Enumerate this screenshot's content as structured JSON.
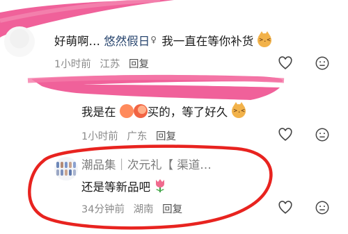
{
  "comments": [
    {
      "text_prefix": "好萌啊… ",
      "nickname": "悠然假日",
      "nickname_icon": "♀",
      "text_suffix": "我一直在等你补货",
      "emoji": "cat-emoji",
      "time": "1小时前",
      "location": "江苏",
      "reply": "回复"
    },
    {
      "text": "我是在",
      "emoji_1": "shrimp-emoji",
      "emoji_2": "peach-emoji",
      "text_suffix": "买的，等了好久",
      "emoji_3": "cat-emoji",
      "time": "1小时前",
      "location": "广东",
      "reply": "回复"
    },
    {
      "author": "潮品集｜次元礼【 渠道…",
      "text": "还是等新品吧",
      "emoji": "tulip-emoji",
      "time": "34分钟前",
      "location": "湖南",
      "reply": "回复"
    }
  ],
  "icons": {
    "like": "heart-icon",
    "dislike": "neutral-face-icon"
  },
  "colors": {
    "scribble": "#f0619a",
    "highlight_circle": "#e8231f",
    "nickname": "#29466f",
    "meta": "#8a8a8a"
  }
}
